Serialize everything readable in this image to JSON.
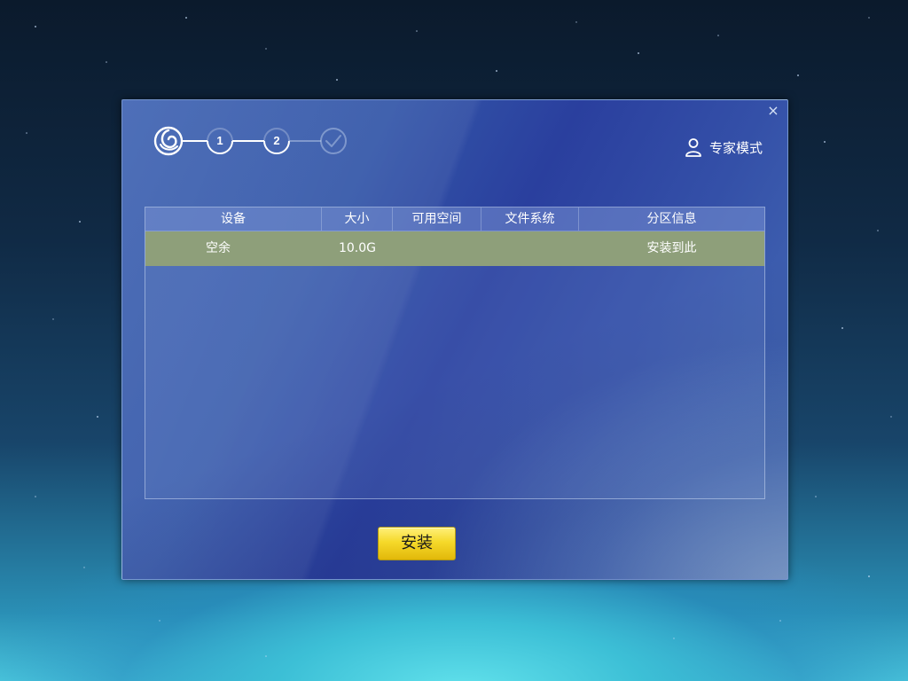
{
  "dialog": {
    "close_glyph": "×"
  },
  "stepper": {
    "steps": [
      "1",
      "2"
    ],
    "logo_icon": "swirl-logo-icon",
    "done_icon": "checkmark-icon"
  },
  "header": {
    "expert_mode_label": "专家模式",
    "expert_mode_icon": "user-icon"
  },
  "table": {
    "columns": [
      "设备",
      "大小",
      "可用空间",
      "文件系统",
      "分区信息"
    ],
    "rows": [
      {
        "device": "空余",
        "size": "10.0G",
        "free_space": "",
        "filesystem": "",
        "partition_info": "安装到此"
      }
    ],
    "selected_row_color": "#8e9f7a"
  },
  "footer": {
    "install_label": "安装",
    "install_color": "#f5d92a"
  }
}
